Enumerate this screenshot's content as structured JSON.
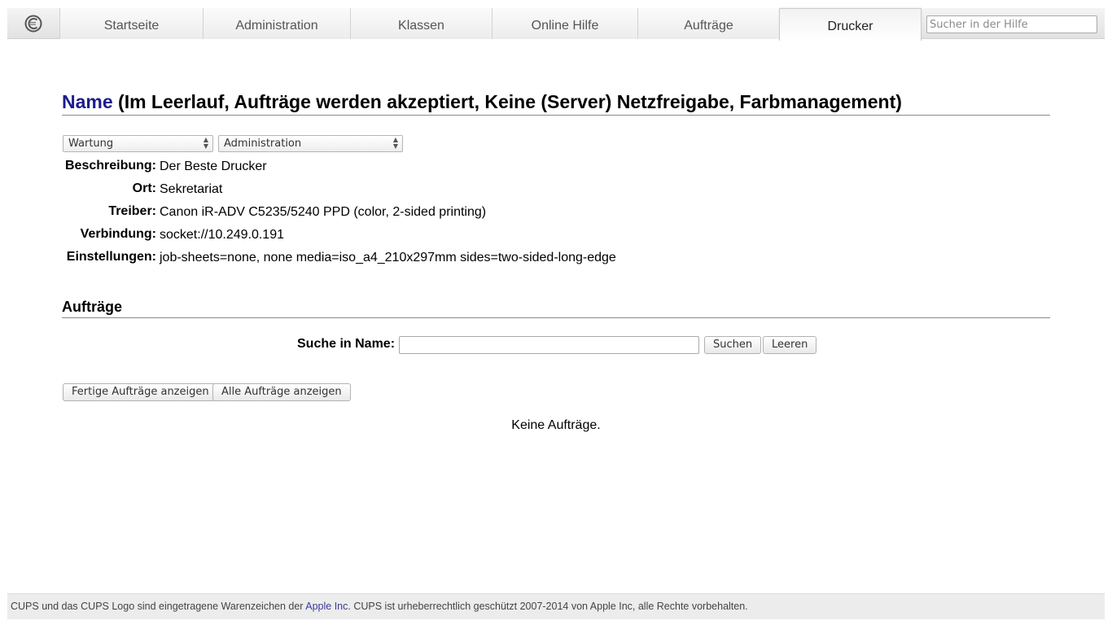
{
  "nav": {
    "tabs": [
      {
        "label": "Startseite"
      },
      {
        "label": "Administration"
      },
      {
        "label": "Klassen"
      },
      {
        "label": "Online Hilfe"
      },
      {
        "label": "Aufträge"
      },
      {
        "label": "Drucker"
      }
    ],
    "active_tab": "Drucker",
    "help_search_placeholder": "Sucher in der Hilfe"
  },
  "printer": {
    "name": "Name",
    "status": "(Im Leerlauf, Aufträge werden akzeptiert, Keine (Server) Netzfreigabe, Farbmanagement)",
    "maintenance_select": "Wartung",
    "admin_select": "Administration",
    "details": [
      {
        "label": "Beschreibung:",
        "value": "Der Beste Drucker"
      },
      {
        "label": "Ort:",
        "value": "Sekretariat"
      },
      {
        "label": "Treiber:",
        "value": "Canon iR-ADV C5235/5240 PPD (color, 2-sided printing)"
      },
      {
        "label": "Verbindung:",
        "value": "socket://10.249.0.191"
      },
      {
        "label": "Einstellungen:",
        "value": "job-sheets=none, none media=iso_a4_210x297mm sides=two-sided-long-edge"
      }
    ]
  },
  "jobs": {
    "heading": "Aufträge",
    "search_label": "Suche in Name:",
    "search_value": "",
    "search_button": "Suchen",
    "clear_button": "Leeren",
    "show_completed_button": "Fertige Aufträge anzeigen",
    "show_all_button": "Alle Aufträge anzeigen",
    "empty_message": "Keine Aufträge."
  },
  "footer": {
    "text_before": "CUPS und das CUPS Logo sind eingetragene Warenzeichen der ",
    "link": "Apple Inc",
    "text_after": ". CUPS ist urheberrechtlich geschützt 2007-2014 von Apple Inc, alle Rechte vorbehalten."
  },
  "colors": {
    "printer_name": "#1c1c8e",
    "footer_link": "#3b3b9a",
    "footer_bg": "#ececec"
  }
}
